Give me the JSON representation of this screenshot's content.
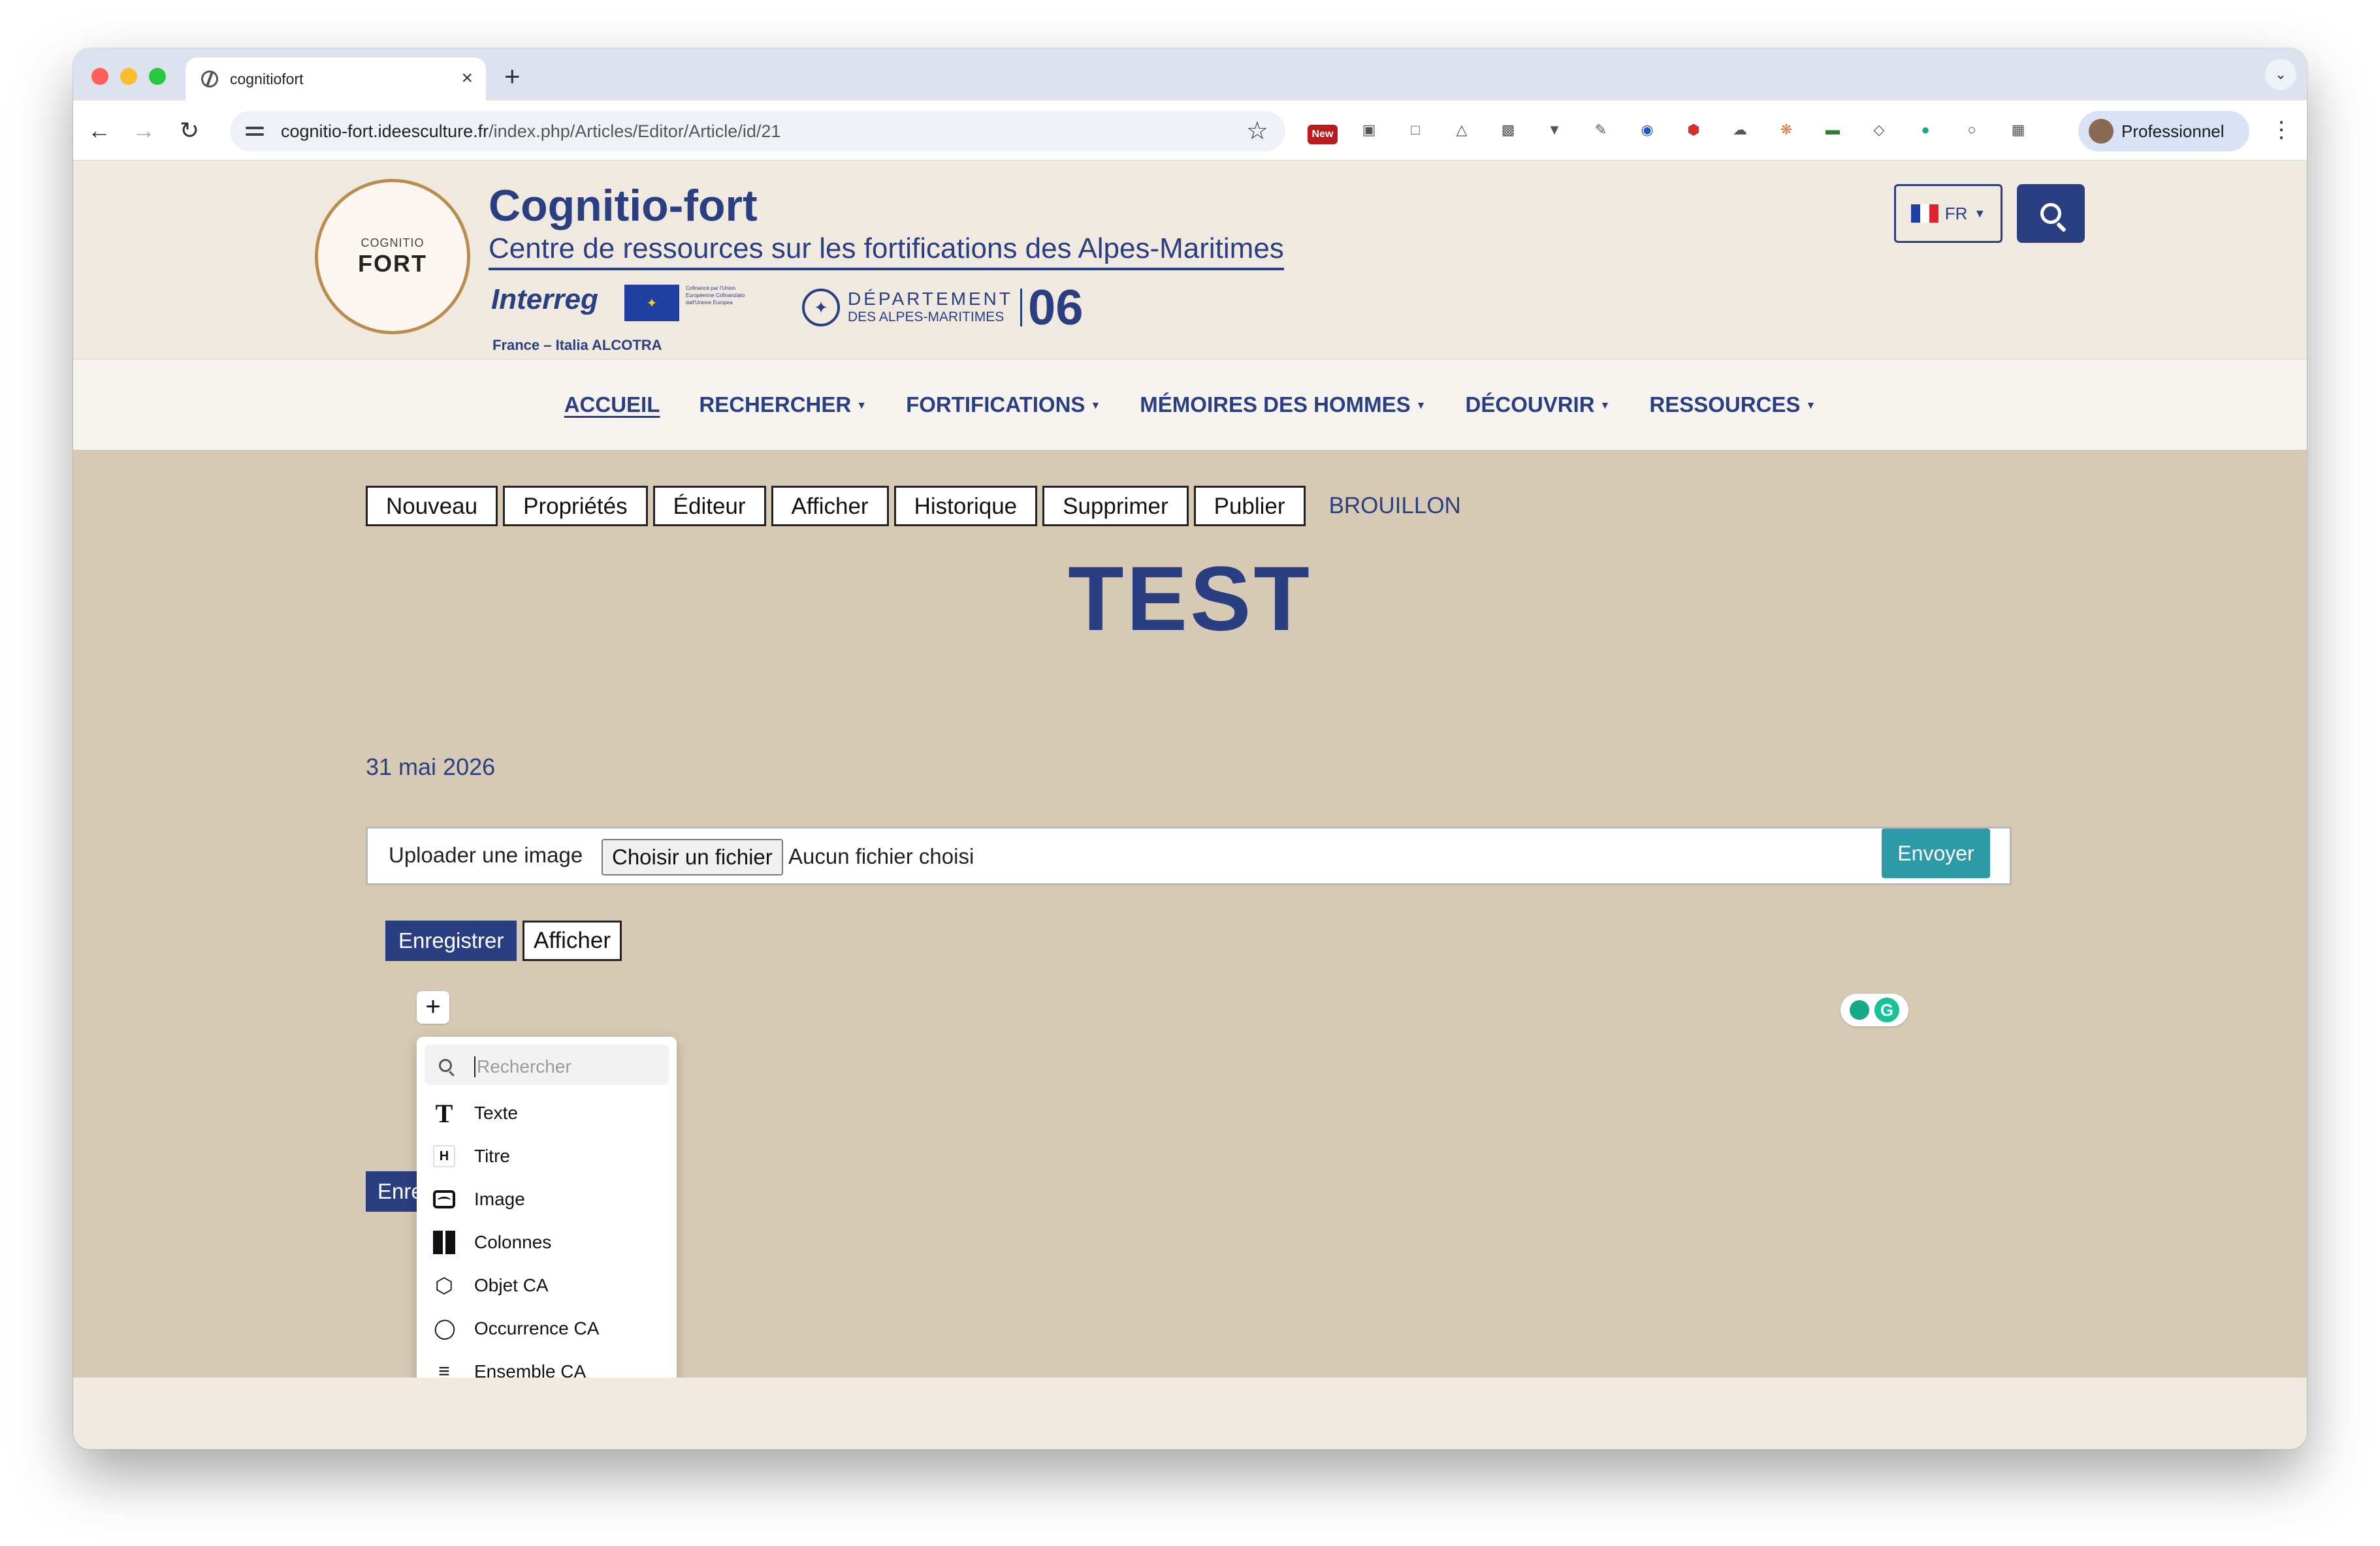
{
  "browser": {
    "tab_title": "cognitiofort",
    "new_tab": "+",
    "close_tab": "×",
    "url_host": "cognitio-fort.ideesculture.fr",
    "url_path": "/index.php/Articles/Editor/Article/id/21",
    "profile_name": "Professionnel",
    "ext_new_badge": "New"
  },
  "header": {
    "site_title": "Cognitio-fort",
    "site_subtitle": "Centre de ressources sur les fortifications des Alpes-Maritimes",
    "logo_small": "COGNITIO",
    "logo_big": "FORT",
    "interreg": "Interreg",
    "eu_text": "Cofinancé par l'Union Européenne Cofinanziato dall'Unione Europea",
    "alcotra": "France – Italia ALCOTRA",
    "dept_line1": "DÉPARTEMENT",
    "dept_line2": "DES ALPES-MARITIMES",
    "dept_number": "06",
    "lang": "FR"
  },
  "nav": {
    "items": [
      {
        "label": "ACCUEIL"
      },
      {
        "label": "RECHERCHER"
      },
      {
        "label": "FORTIFICATIONS"
      },
      {
        "label": "MÉMOIRES DES HOMMES"
      },
      {
        "label": "DÉCOUVRIR"
      },
      {
        "label": "RESSOURCES"
      }
    ]
  },
  "actions": {
    "buttons": [
      "Nouveau",
      "Propriétés",
      "Éditeur",
      "Afficher",
      "Historique",
      "Supprimer",
      "Publier"
    ],
    "status": "BROUILLON"
  },
  "article": {
    "title": "TEST",
    "date": "31 mai 2026"
  },
  "upload": {
    "label": "Uploader une image",
    "choose_file": "Choisir un fichier",
    "no_file": "Aucun fichier choisi",
    "send": "Envoyer"
  },
  "editor": {
    "save": "Enregistrer",
    "view": "Afficher",
    "add_block": "+",
    "save_partial": "Enregistrer"
  },
  "block_menu": {
    "search_placeholder": "Rechercher",
    "items": [
      {
        "label": "Texte",
        "icon": "text-icon"
      },
      {
        "label": "Titre",
        "icon": "heading-icon"
      },
      {
        "label": "Image",
        "icon": "image-icon"
      },
      {
        "label": "Colonnes",
        "icon": "columns-icon"
      },
      {
        "label": "Objet CA",
        "icon": "cube-icon"
      },
      {
        "label": "Occurrence CA",
        "icon": "tag-icon"
      },
      {
        "label": "Ensemble CA",
        "icon": "layers-icon"
      }
    ]
  },
  "colors": {
    "brand_blue": "#2a3e82",
    "content_bg": "#d7cab5",
    "header_bg": "#efe9e0",
    "send_teal": "#2d9aa7"
  }
}
